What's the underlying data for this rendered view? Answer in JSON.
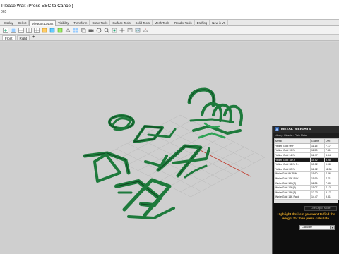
{
  "command": {
    "line1": "Please Wait (Press ESC to Cancel)",
    "line2": "065"
  },
  "ribbon_tabs": [
    {
      "label": "Display",
      "active": false
    },
    {
      "label": "Select",
      "active": false
    },
    {
      "label": "Viewport Layout",
      "active": true
    },
    {
      "label": "Visibility",
      "active": false
    },
    {
      "label": "Transform",
      "active": false
    },
    {
      "label": "Curve Tools",
      "active": false
    },
    {
      "label": "Surface Tools",
      "active": false
    },
    {
      "label": "Solid Tools",
      "active": false
    },
    {
      "label": "Mesh Tools",
      "active": false
    },
    {
      "label": "Render Tools",
      "active": false
    },
    {
      "label": "Drafting",
      "active": false
    },
    {
      "label": "New in V5",
      "active": false
    }
  ],
  "toolbar_icons": [
    "new-viewport-icon",
    "maximize-viewport-icon",
    "split-horizontal-icon",
    "split-vertical-icon",
    "viewport-layout-icon",
    "top-view-icon",
    "front-view-icon",
    "right-view-icon",
    "perspective-view-icon",
    "four-views-icon",
    "parallel-view-icon",
    "camera-icon",
    "rotate-view-icon",
    "zoom-window-icon",
    "zoom-extents-icon",
    "pan-icon",
    "named-view-icon",
    "background-bitmap-icon",
    "cplane-icon"
  ],
  "viewport_tabs": [
    {
      "label": "Front",
      "active": true
    },
    {
      "label": "Right",
      "active": false
    }
  ],
  "viewport_add_label": "+",
  "metal_weights": {
    "title": "METAL WEIGHTS",
    "library": "Library: Classic - Plain Metal",
    "columns": [
      "Metal",
      "Grams",
      "DWT"
    ],
    "rows": [
      [
        "Yellow Gold 9KY",
        "11.15",
        "7.17"
      ],
      [
        "Yellow Gold 10KY",
        "11.53",
        "7.41"
      ],
      [
        "Yellow Gold 14KY",
        "12.97",
        "8.34"
      ],
      [
        "Yellow Gold 18KY",
        "15.52",
        "9.98"
      ],
      [
        "Yellow Gold 18KY R...",
        "15.52",
        "9.98"
      ],
      [
        "Yellow Gold 22KY",
        "18.02",
        "11.58"
      ],
      [
        "White Gold 9K R/W",
        "11.60",
        "7.46"
      ],
      [
        "White Gold 10K R/W",
        "11.99",
        "7.71"
      ],
      [
        "White Gold 10K(S)",
        "11.36",
        "7.30"
      ],
      [
        "White Gold 10K(9)",
        "11.07",
        "7.12"
      ],
      [
        "White Gold 14K(S)",
        "12.73",
        "8.17"
      ],
      [
        "White Gold 14K Palld",
        "14.47",
        "9.31"
      ]
    ],
    "selected_index": 3,
    "button_label": "Live Object Mode",
    "instruction": "Highlight the item you want to find the weight for then press calculate.",
    "input_value": "Calculate"
  }
}
